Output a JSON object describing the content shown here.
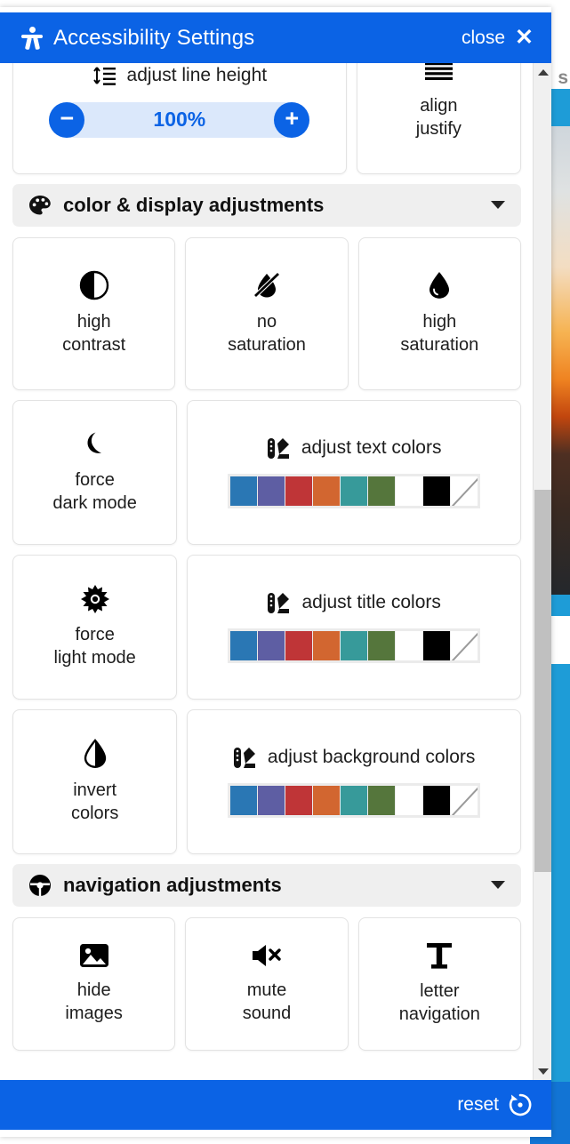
{
  "header": {
    "title": "Accessibility Settings",
    "close_label": "close",
    "close_icon": "close-x-icon",
    "person_icon": "accessibility-person-icon",
    "bg_color": "#0b63e5"
  },
  "clipped_top_cards": [
    {
      "label": ""
    },
    {
      "label": ""
    }
  ],
  "line_height": {
    "title": "adjust line height",
    "icon": "line-height-icon",
    "value": "100%",
    "decrease_label": "−",
    "increase_label": "+",
    "track_color": "#dbe8fb",
    "accent_color": "#0b63e5"
  },
  "align_justify": {
    "label_line1": "align",
    "label_line2": "justify",
    "icon": "align-justify-icon"
  },
  "sections": [
    {
      "id": "color-display",
      "title": "color & display adjustments",
      "icon": "palette-icon",
      "chevron": "chevron-down-icon"
    },
    {
      "id": "navigation",
      "title": "navigation adjustments",
      "icon": "steering-wheel-icon",
      "chevron": "chevron-down-icon"
    }
  ],
  "color_cards": [
    {
      "icon": "contrast-circle-icon",
      "line1": "high",
      "line2": "contrast"
    },
    {
      "icon": "droplet-slash-icon",
      "line1": "no",
      "line2": "saturation"
    },
    {
      "icon": "droplet-icon",
      "line1": "high",
      "line2": "saturation"
    }
  ],
  "mode_cards": [
    {
      "icon": "moon-icon",
      "line1": "force",
      "line2": "dark mode"
    },
    {
      "icon": "sun-icon",
      "line1": "force",
      "line2": "light mode"
    },
    {
      "icon": "droplet-half-icon",
      "line1": "invert",
      "line2": "colors"
    }
  ],
  "color_pickers": [
    {
      "title": "adjust text colors",
      "icon": "color-swatch-icon"
    },
    {
      "title": "adjust title colors",
      "icon": "color-swatch-icon"
    },
    {
      "title": "adjust background colors",
      "icon": "color-swatch-icon"
    }
  ],
  "swatch_colors": [
    "#2a77b4",
    "#5e5ea3",
    "#bf3537",
    "#d26630",
    "#379a9a",
    "#55763c",
    "#ffffff",
    "#000000",
    "none"
  ],
  "nav_cards": [
    {
      "icon": "image-icon",
      "line1": "hide",
      "line2": "images"
    },
    {
      "icon": "mute-speaker-icon",
      "line1": "mute",
      "line2": "sound"
    },
    {
      "icon": "letter-t-icon",
      "line1": "letter",
      "line2": "navigation"
    }
  ],
  "footer": {
    "reset_label": "reset",
    "reset_icon": "reset-circular-arrow-icon",
    "bg_color": "#0b63e5"
  },
  "scrollbar": {
    "up_icon": "scroll-up-arrow-icon",
    "down_icon": "scroll-down-arrow-icon",
    "thumb": "scroll-thumb"
  },
  "background_page": {
    "visible_text": "s"
  }
}
